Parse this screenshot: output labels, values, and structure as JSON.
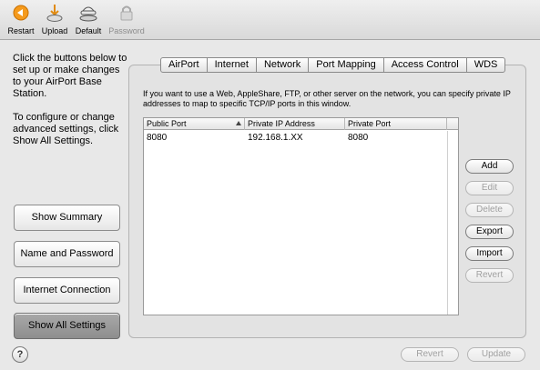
{
  "toolbar": {
    "restart": "Restart",
    "upload": "Upload",
    "default": "Default",
    "password": "Password"
  },
  "sidebar": {
    "instructions_1": "Click the buttons below to set up or make changes to your AirPort Base Station.",
    "instructions_2": "To configure or change advanced settings, click Show All Settings.",
    "buttons": [
      {
        "label": "Show Summary"
      },
      {
        "label": "Name and Password"
      },
      {
        "label": "Internet Connection"
      },
      {
        "label": "Show All Settings"
      }
    ]
  },
  "tabs": [
    "AirPort",
    "Internet",
    "Network",
    "Port Mapping",
    "Access Control",
    "WDS"
  ],
  "main": {
    "description": "If you want to use a Web, AppleShare, FTP, or other server on the network, you can specify private IP addresses to map to specific TCP/IP ports in this window.",
    "columns": [
      "Public Port",
      "Private IP Address",
      "Private Port"
    ],
    "rows": [
      {
        "public_port": "8080",
        "private_ip": "192.168.1.XX",
        "private_port": "8080"
      }
    ]
  },
  "actions": {
    "add": "Add",
    "edit": "Edit",
    "delete": "Delete",
    "export": "Export",
    "import": "Import",
    "revert": "Revert"
  },
  "footer": {
    "help": "?",
    "revert": "Revert",
    "update": "Update"
  }
}
